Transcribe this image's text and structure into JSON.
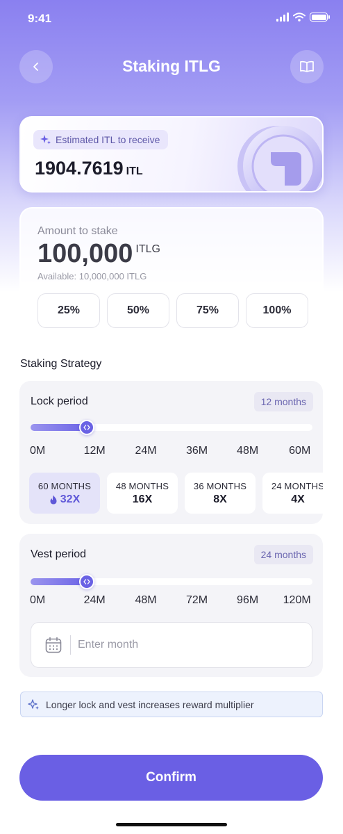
{
  "status_bar": {
    "time": "9:41"
  },
  "header": {
    "title": "Staking ITLG",
    "back_icon": "chevron-left-icon",
    "book_icon": "book-open-icon"
  },
  "estimate": {
    "label": "Estimated ITL to receive",
    "value": "1904.7619",
    "unit": "ITL"
  },
  "stake": {
    "label": "Amount to stake",
    "amount": "100,000",
    "unit": "ITLG",
    "available": "Available: 10,000,000 ITLG",
    "percent_options": [
      "25%",
      "50%",
      "75%",
      "100%"
    ]
  },
  "strategy": {
    "title": "Staking Strategy",
    "lock": {
      "title": "Lock period",
      "badge": "12 months",
      "slider_value_fraction": 0.2,
      "ticks": [
        "0M",
        "12M",
        "24M",
        "36M",
        "48M",
        "60M"
      ],
      "multipliers": [
        {
          "months": "60 MONTHS",
          "value": "32X",
          "selected": true
        },
        {
          "months": "48 MONTHS",
          "value": "16X",
          "selected": false
        },
        {
          "months": "36 MONTHS",
          "value": "8X",
          "selected": false
        },
        {
          "months": "24 MONTHS",
          "value": "4X",
          "selected": false
        }
      ]
    },
    "vest": {
      "title": "Vest period",
      "badge": "24 months",
      "slider_value_fraction": 0.2,
      "ticks": [
        "0M",
        "24M",
        "48M",
        "72M",
        "96M",
        "120M"
      ],
      "input_placeholder": "Enter month"
    }
  },
  "hint": "Longer lock and vest increases reward multiplier",
  "confirm_label": "Confirm",
  "colors": {
    "accent": "#6a5fe4",
    "accent_light": "#e4e3f9",
    "panel": "#f4f4f8"
  }
}
